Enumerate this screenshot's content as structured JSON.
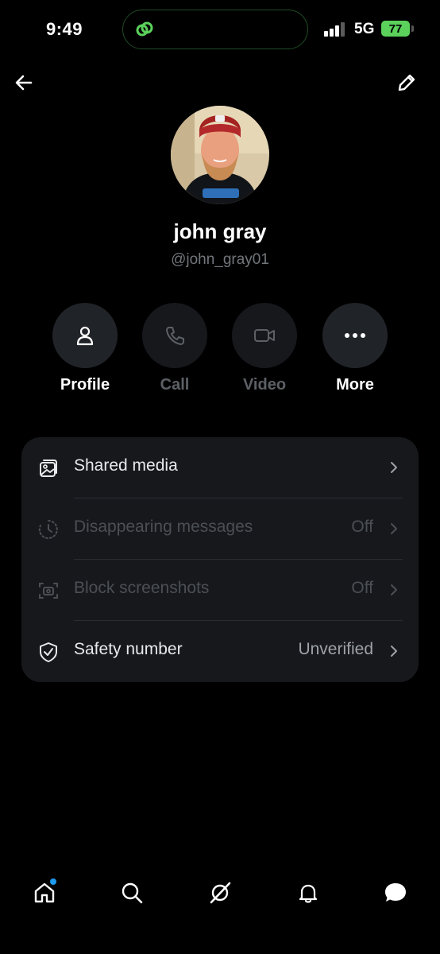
{
  "status_bar": {
    "time": "9:49",
    "network": "5G",
    "battery": "77"
  },
  "header": {
    "back_icon": "arrow-left-icon",
    "edit_icon": "pencil-icon"
  },
  "profile": {
    "name": "john gray",
    "handle": "@john_gray01"
  },
  "actions": [
    {
      "label": "Profile",
      "icon": "person-icon",
      "enabled": true
    },
    {
      "label": "Call",
      "icon": "phone-icon",
      "enabled": false
    },
    {
      "label": "Video",
      "icon": "video-camera-icon",
      "enabled": false
    },
    {
      "label": "More",
      "icon": "more-dots-icon",
      "enabled": true
    }
  ],
  "settings": [
    {
      "label": "Shared media",
      "value": "",
      "icon": "media-icon",
      "enabled": true
    },
    {
      "label": "Disappearing messages",
      "value": "Off",
      "icon": "timer-icon",
      "enabled": false
    },
    {
      "label": "Block screenshots",
      "value": "Off",
      "icon": "screenshot-icon",
      "enabled": false
    },
    {
      "label": "Safety number",
      "value": "Unverified",
      "icon": "shield-check-icon",
      "enabled": true
    }
  ],
  "tab_bar": {
    "tabs": [
      "home-icon",
      "search-icon",
      "grok-icon",
      "bell-icon",
      "messages-icon"
    ],
    "home_notification": true
  },
  "colors": {
    "background": "#000000",
    "card": "#16181c",
    "accent": "#1d9bf0",
    "battery": "#5bd15c",
    "muted_text": "#71767b"
  }
}
